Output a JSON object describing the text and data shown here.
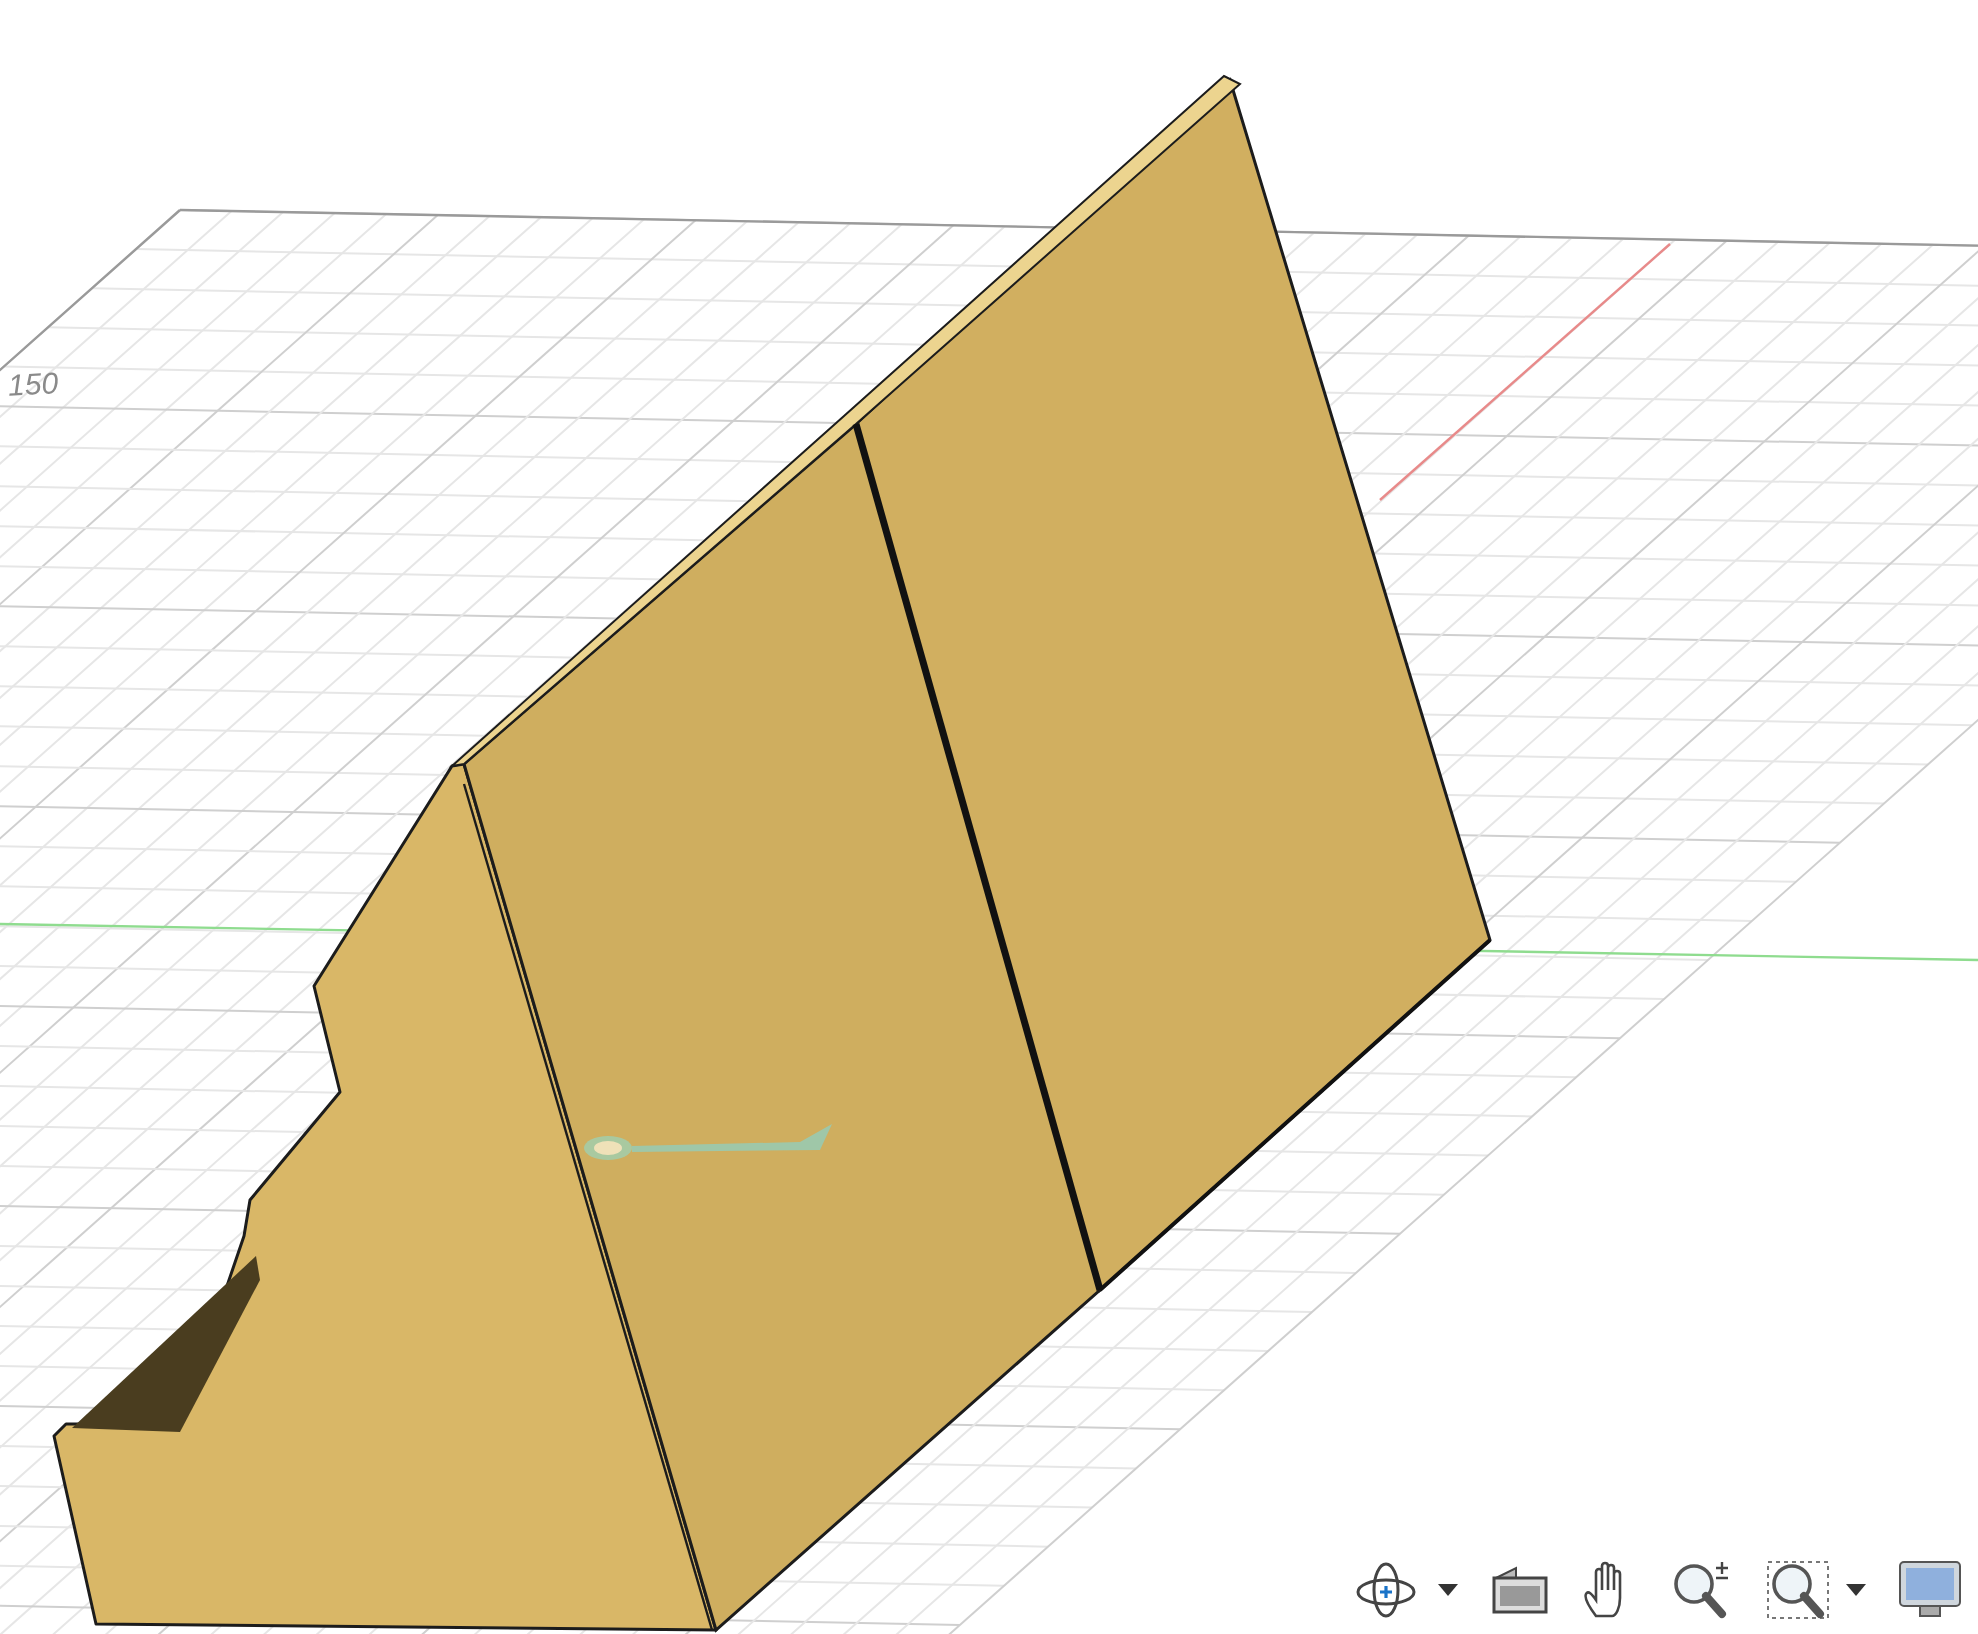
{
  "viewport": {
    "grid_label": "150"
  },
  "toolbar": [
    {
      "kind": "orbit",
      "dropdown": true
    },
    {
      "kind": "look_at",
      "dropdown": false
    },
    {
      "kind": "pan",
      "dropdown": false
    },
    {
      "kind": "zoom",
      "dropdown": false
    },
    {
      "kind": "zoom_window",
      "dropdown": true
    },
    {
      "kind": "display",
      "dropdown": false
    }
  ]
}
